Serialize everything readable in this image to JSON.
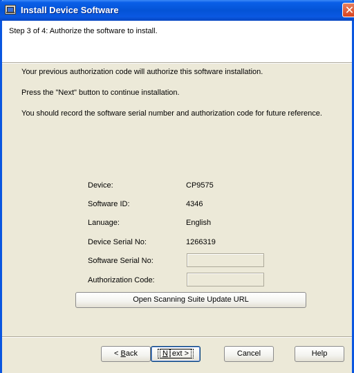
{
  "window": {
    "title": "Install Device Software",
    "close_glyph": "✕"
  },
  "step": "Step 3 of 4:  Authorize the software to install.",
  "paragraphs": [
    "Your previous authorization code will authorize this software installation.",
    "Press the \"Next\" button to continue installation.",
    "You should record the software serial number and authorization code for future reference."
  ],
  "fields": {
    "device": {
      "label": "Device:",
      "value": "CP9575"
    },
    "software_id": {
      "label": "Software ID:",
      "value": "4346"
    },
    "language": {
      "label": "Lanuage:",
      "value": "English"
    },
    "device_serial": {
      "label": "Device Serial No:",
      "value": "1266319"
    },
    "software_serial": {
      "label": "Software Serial No:",
      "value": ""
    },
    "auth_code": {
      "label": "Authorization Code:",
      "value": ""
    }
  },
  "buttons": {
    "open_url": "Open Scanning Suite Update URL",
    "back_prefix": "< ",
    "back_key": "B",
    "back_rest": "ack",
    "next_key": "N",
    "next_rest": "ext >",
    "cancel": "Cancel",
    "help": "Help"
  },
  "icons": {
    "title": "install-app-icon",
    "close": "close-icon"
  }
}
